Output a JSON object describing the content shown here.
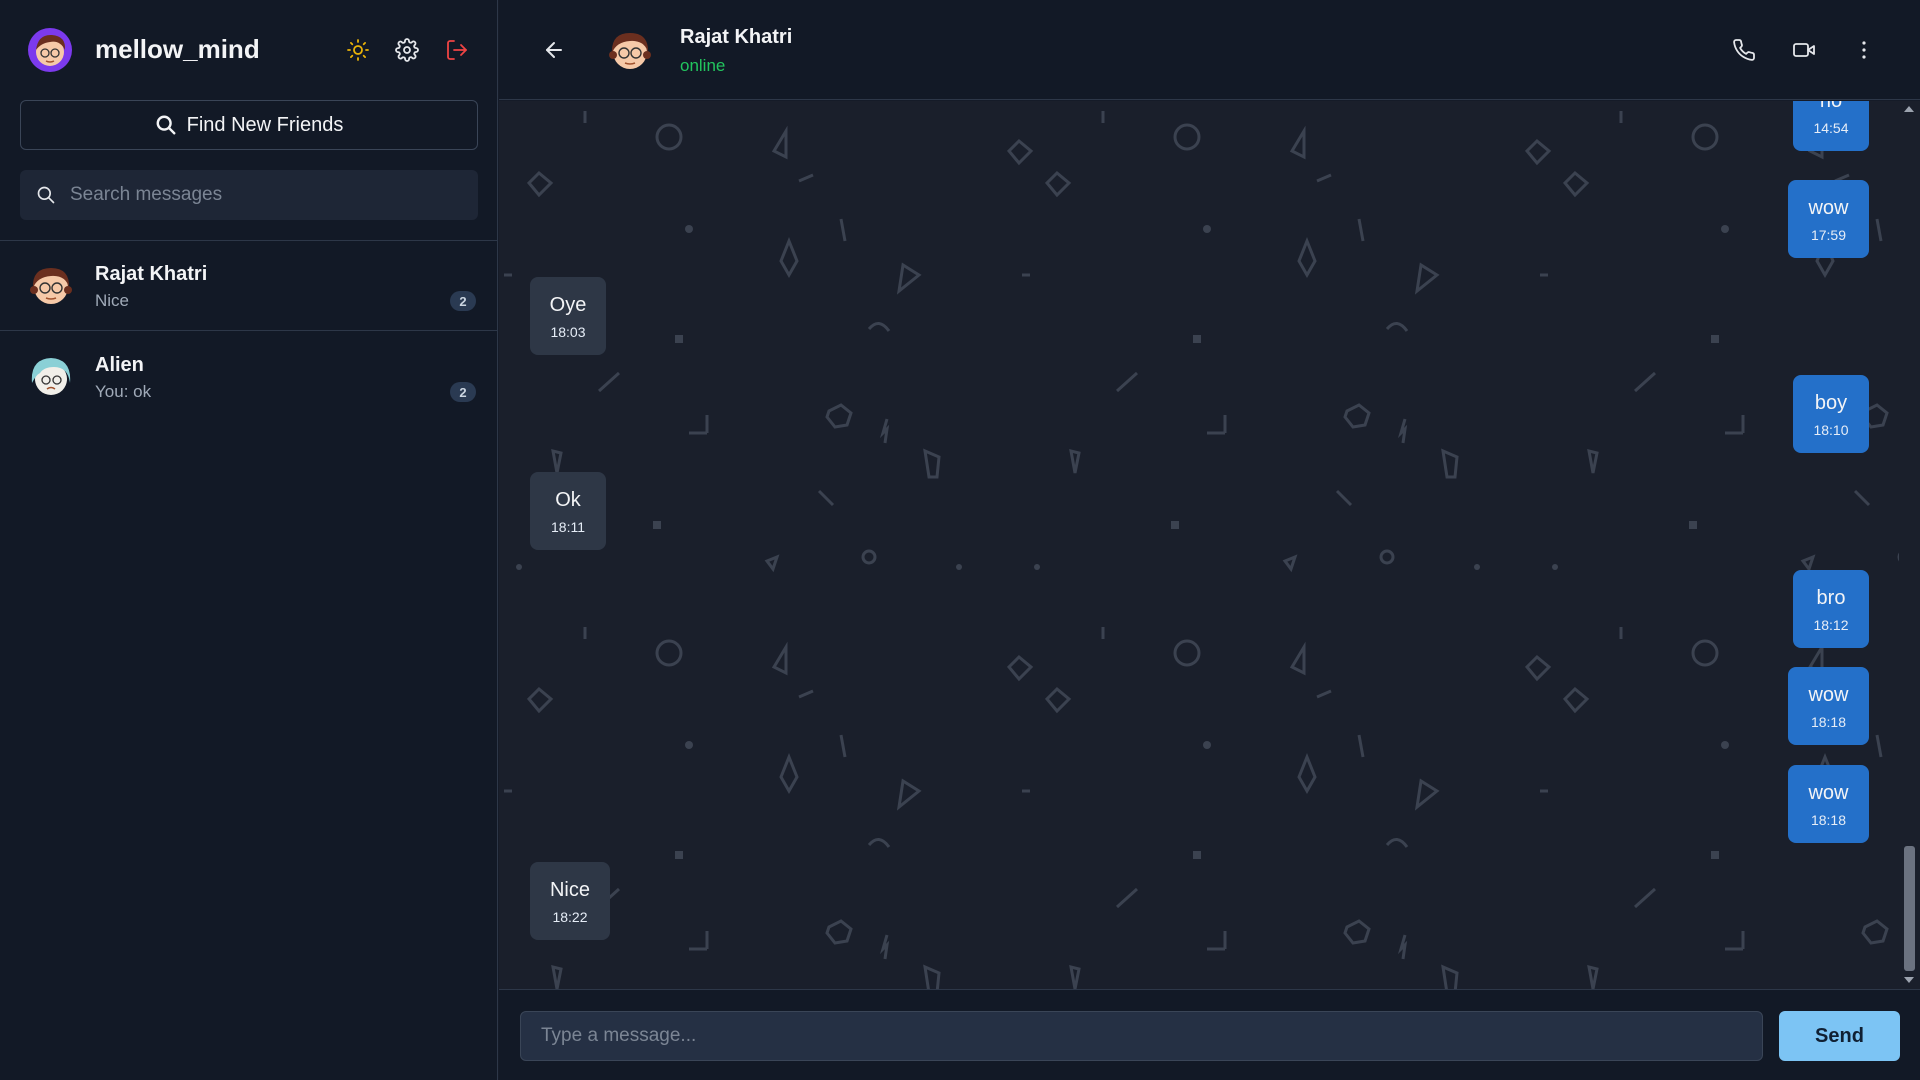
{
  "app": {
    "name": "mellow_mind"
  },
  "sidebar": {
    "find_friends_label": "Find New Friends",
    "search_placeholder": "Search messages",
    "contacts": [
      {
        "name": "Rajat Khatri",
        "last_message": "Nice",
        "unread": "2",
        "avatar": "girl-glasses-avatar"
      },
      {
        "name": "Alien",
        "last_message": "You: ok",
        "unread": "2",
        "avatar": "blue-hair-avatar"
      }
    ]
  },
  "chat": {
    "contact_name": "Rajat Khatri",
    "status": "online",
    "messages": [
      {
        "dir": "out",
        "text": "ho",
        "time": "14:54"
      },
      {
        "dir": "out",
        "text": "wow",
        "time": "17:59"
      },
      {
        "dir": "in",
        "text": "Oye",
        "time": "18:03"
      },
      {
        "dir": "out",
        "text": "boy",
        "time": "18:10"
      },
      {
        "dir": "in",
        "text": "Ok",
        "time": "18:11"
      },
      {
        "dir": "out",
        "text": "bro",
        "time": "18:12"
      },
      {
        "dir": "out",
        "text": "wow",
        "time": "18:18"
      },
      {
        "dir": "out",
        "text": "wow",
        "time": "18:18"
      },
      {
        "dir": "in",
        "text": "Nice",
        "time": "18:22"
      }
    ]
  },
  "composer": {
    "placeholder": "Type a message...",
    "send_label": "Send"
  },
  "colors": {
    "accent": "#2470c9",
    "send": "#7cc4f4",
    "online": "#22c55e",
    "logout": "#ef4444",
    "theme_icon": "#eab308"
  },
  "icons": [
    "sun-icon",
    "gear-icon",
    "logout-icon",
    "search-icon",
    "back-arrow-icon",
    "phone-icon",
    "video-icon",
    "more-vertical-icon"
  ]
}
